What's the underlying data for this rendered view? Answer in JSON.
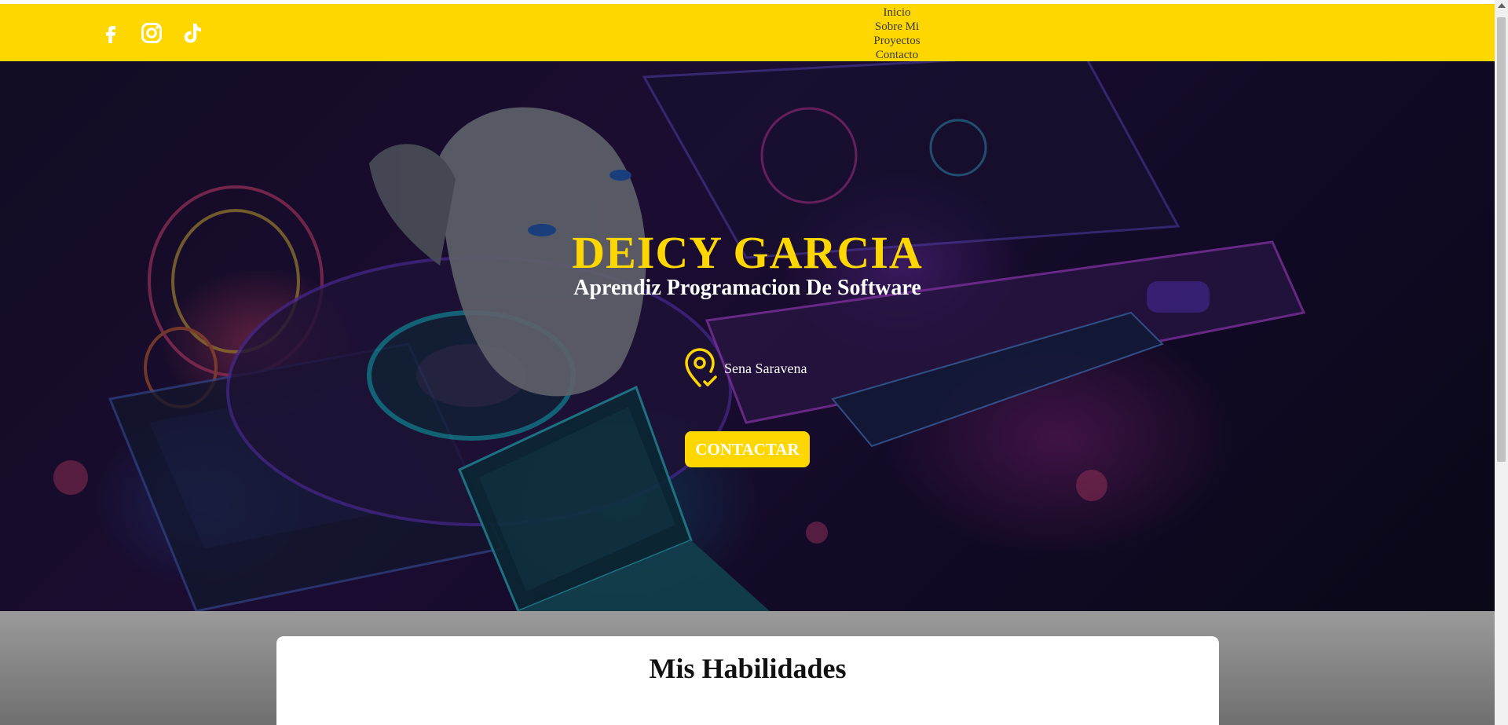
{
  "header": {
    "social": [
      {
        "icon": "facebook-icon"
      },
      {
        "icon": "instagram-icon"
      },
      {
        "icon": "tiktok-icon"
      }
    ],
    "nav": [
      "Inicio",
      "Sobre Mi",
      "Proyectos",
      "Contacto"
    ]
  },
  "hero": {
    "name": "DEICY GARCIA",
    "subtitle": "Aprendiz Programacion De Software",
    "location": "Sena Saravena",
    "contact_label": "CONTACTAR"
  },
  "skills": {
    "title": "Mis Habilidades"
  },
  "colors": {
    "accent": "#ffd700",
    "text_light": "#ffffff",
    "page_bg": "#7f7f7f"
  }
}
